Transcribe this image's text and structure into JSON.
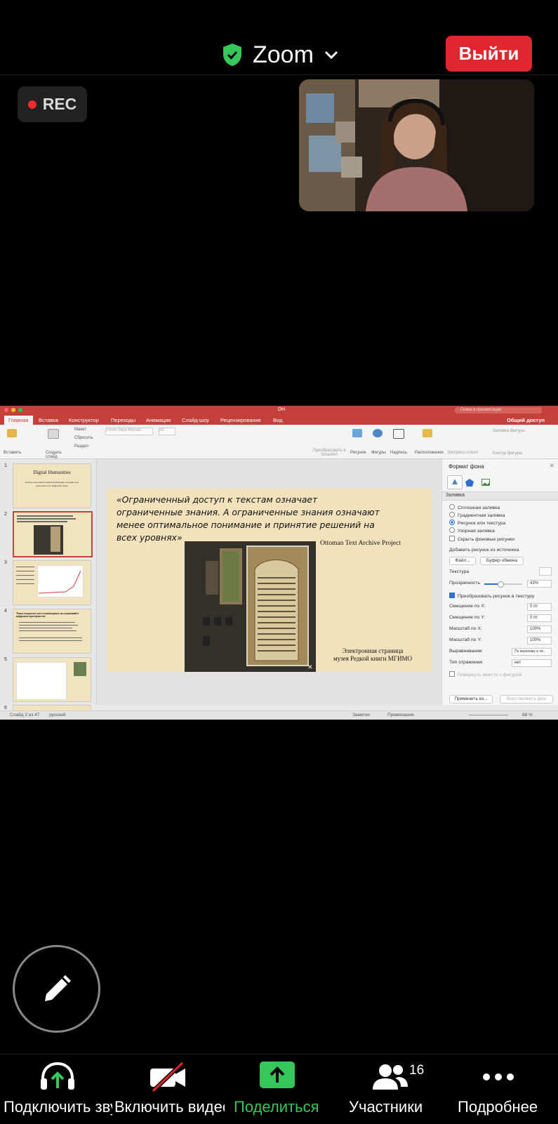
{
  "header": {
    "meeting_name": "Zoom",
    "leave_label": "Выйти",
    "rec_label": "REC"
  },
  "shared_screen": {
    "window_title": "DH",
    "search_placeholder": "Поиск в презентации",
    "share_label": "Общий доступ",
    "tabs": [
      "Главная",
      "Вставка",
      "Конструктор",
      "Переходы",
      "Анимация",
      "Слайд-шоу",
      "Рецензирование",
      "Вид"
    ],
    "ribbon": {
      "paste": "Вставить",
      "new_slide": "Создать слайд",
      "layout": "Макет",
      "reset": "Сбросить",
      "section": "Раздел",
      "font": "Times New Roman",
      "font_size": "20",
      "convert_smartart": "Преобразовать в SmartArt",
      "picture": "Рисунок",
      "shapes": "Фигуры",
      "textbox": "Надпись",
      "arrange": "Расположение",
      "express_styles": "Экспресс-стили",
      "shape_fill": "Заливка фигуры",
      "shape_outline": "Контур фигуры"
    },
    "thumbnails": [
      {
        "num": "1",
        "title": "Digital Humanities",
        "subtitle": "Центры изучения Османской империи в Турции и их деятельность в цифровой среде"
      },
      {
        "num": "2"
      },
      {
        "num": "3"
      },
      {
        "num": "4",
        "title": "Типы открытых для гуманитарных исследований в цифровом пространстве"
      },
      {
        "num": "5"
      },
      {
        "num": "6"
      }
    ],
    "slide": {
      "quote_lines": [
        "«Ограниченный доступ к текстам означает",
        "ограниченные знания. А ограниченные знания означают",
        "менее оптимальное понимание и принятие решений на",
        "всех уровнях»"
      ],
      "source": "Ottoman Text Archive Project",
      "caption_line1": "Электронная страница",
      "caption_line2": "музея Редкой книги МГИМО"
    },
    "format_pane": {
      "title": "Формат фона",
      "section": "Заливка",
      "options": [
        "Сплошная заливка",
        "Градиентная заливка",
        "Рисунок или текстура",
        "Узорная заливка"
      ],
      "selected_option": "Рисунок или текстура",
      "hide_bg": "Скрыть фоновые рисунки",
      "insert_from": "Добавить рисунок из источника",
      "file_btn": "Файл...",
      "clipboard_btn": "Буфер обмена",
      "texture": "Текстура",
      "transparency": "Прозрачность",
      "transparency_value": "43%",
      "transparency_level": 0.43,
      "tile": "Преобразовать рисунок в текстуру",
      "offset_x": "Смещение по X:",
      "offset_x_val": "0 пт",
      "offset_y": "Смещение по Y:",
      "offset_y_val": "0 пт",
      "scale_x": "Масштаб по X:",
      "scale_x_val": "100%",
      "scale_y": "Масштаб по Y:",
      "scale_y_val": "100%",
      "alignment": "Выравнивание",
      "alignment_val": "По верхнему и ле...",
      "mirror": "Тип отражения",
      "mirror_val": "нет",
      "rotate_with": "Повернуть вместе с фигурой",
      "apply_btn": "Применить ко...",
      "reset_btn": "Восстановить фон"
    },
    "status": {
      "slide_count": "Слайд 2 из 47",
      "language": "русский",
      "notes": "Заметки",
      "comments": "Примечания",
      "zoom": "88 %"
    }
  },
  "toolbar": {
    "audio_label": "Подключить звук",
    "video_label": "Включить видео",
    "share_label": "Поделиться",
    "participants_label": "Участники",
    "participants_count": "16",
    "more_label": "Подробнее"
  },
  "colors": {
    "leave": "#e0262e",
    "share_green": "#35c759",
    "ppt_red": "#c4413b",
    "slide_bg": "#f1e2bc"
  }
}
